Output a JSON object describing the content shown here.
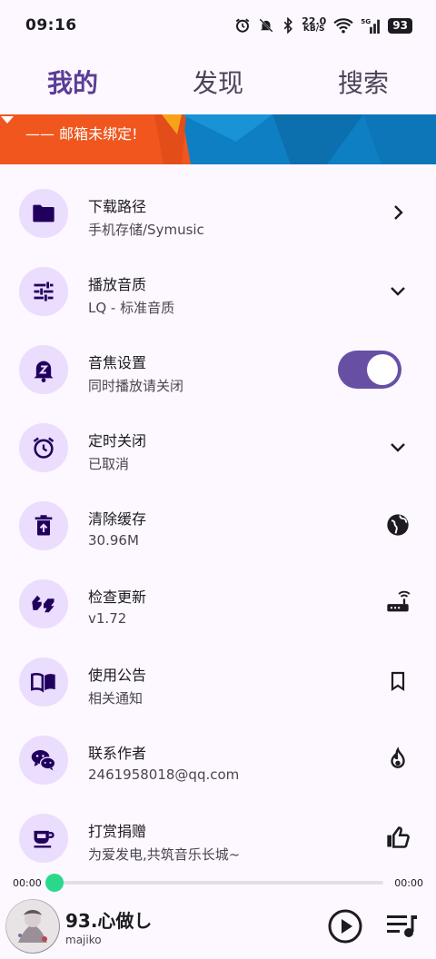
{
  "status": {
    "time": "09:16",
    "net_speed_value": "22.0",
    "net_speed_unit": "KB/S",
    "battery": "93",
    "signal_label": "5G"
  },
  "tabs": [
    {
      "label": "我的",
      "active": true
    },
    {
      "label": "发现",
      "active": false
    },
    {
      "label": "搜索",
      "active": false
    }
  ],
  "banner": {
    "text": "—— 邮箱未绑定!"
  },
  "settings": [
    {
      "title": "下载路径",
      "subtitle": "手机存储/Symusic",
      "icon": "folder-icon",
      "trailing": "chevron-right-icon"
    },
    {
      "title": "播放音质",
      "subtitle": "LQ - 标准音质",
      "icon": "tune-icon",
      "trailing": "chevron-down-icon"
    },
    {
      "title": "音焦设置",
      "subtitle": "同时播放请关闭",
      "icon": "bell-z-icon",
      "trailing": "toggle",
      "toggle_on": true
    },
    {
      "title": "定时关闭",
      "subtitle": "已取消",
      "icon": "alarm-icon",
      "trailing": "chevron-down-icon"
    },
    {
      "title": "清除缓存",
      "subtitle": "30.96M",
      "icon": "delete-restore-icon",
      "trailing": "globe-icon"
    },
    {
      "title": "检查更新",
      "subtitle": "v1.72",
      "icon": "quote-icon",
      "trailing": "router-icon"
    },
    {
      "title": "使用公告",
      "subtitle": "相关通知",
      "icon": "book-icon",
      "trailing": "bookmark-icon"
    },
    {
      "title": "联系作者",
      "subtitle": "2461958018@qq.com",
      "icon": "wechat-icon",
      "trailing": "fire-icon"
    },
    {
      "title": "打赏捐赠",
      "subtitle": "为爱发电,共筑音乐长城~",
      "icon": "coffee-icon",
      "trailing": "thumb-up-icon"
    }
  ],
  "player": {
    "current_time": "00:00",
    "total_time": "00:00",
    "progress": 0,
    "song_title": "93.心做し",
    "artist": "majiko"
  },
  "colors": {
    "accent": "#6750a4",
    "icon_bg": "#eaddfe",
    "progress_thumb": "#2ad88b",
    "banner_orange": "#f0561e",
    "banner_blue": "#0f7fc4"
  }
}
